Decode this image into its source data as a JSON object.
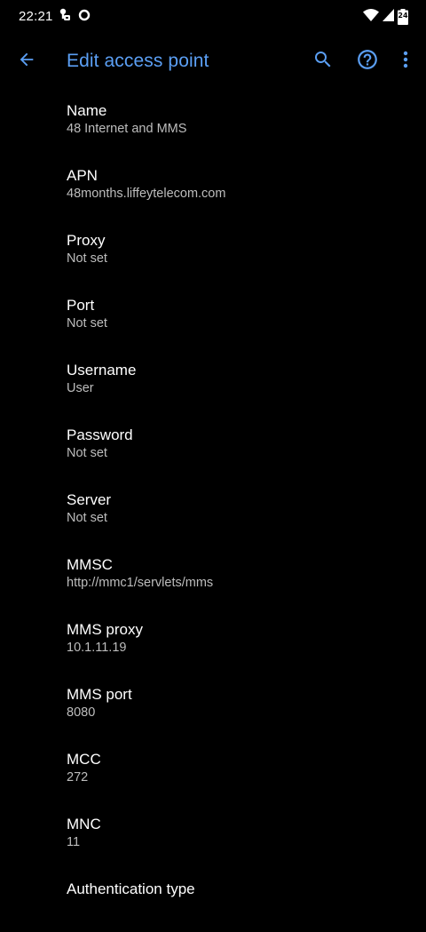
{
  "status_bar": {
    "time": "22:21",
    "battery_level": "24",
    "left_icons": [
      "alarm-lock-icon",
      "circle-icon"
    ],
    "right_icons": [
      "wifi-icon",
      "cell-signal-icon",
      "battery-icon"
    ]
  },
  "app_bar": {
    "title": "Edit access point",
    "accent_color": "#5b9ff4",
    "icons": [
      "back-arrow-icon",
      "search-icon",
      "help-icon",
      "more-vert-icon"
    ]
  },
  "settings": {
    "items": [
      {
        "title": "Name",
        "summary": "48 Internet and MMS"
      },
      {
        "title": "APN",
        "summary": "48months.liffeytelecom.com"
      },
      {
        "title": "Proxy",
        "summary": "Not set"
      },
      {
        "title": "Port",
        "summary": "Not set"
      },
      {
        "title": "Username",
        "summary": "User"
      },
      {
        "title": "Password",
        "summary": "Not set"
      },
      {
        "title": "Server",
        "summary": "Not set"
      },
      {
        "title": "MMSC",
        "summary": "http://mmc1/servlets/mms"
      },
      {
        "title": "MMS proxy",
        "summary": "10.1.11.19"
      },
      {
        "title": "MMS port",
        "summary": "8080"
      },
      {
        "title": "MCC",
        "summary": "272"
      },
      {
        "title": "MNC",
        "summary": "11"
      },
      {
        "title": "Authentication type",
        "summary": ""
      }
    ]
  }
}
